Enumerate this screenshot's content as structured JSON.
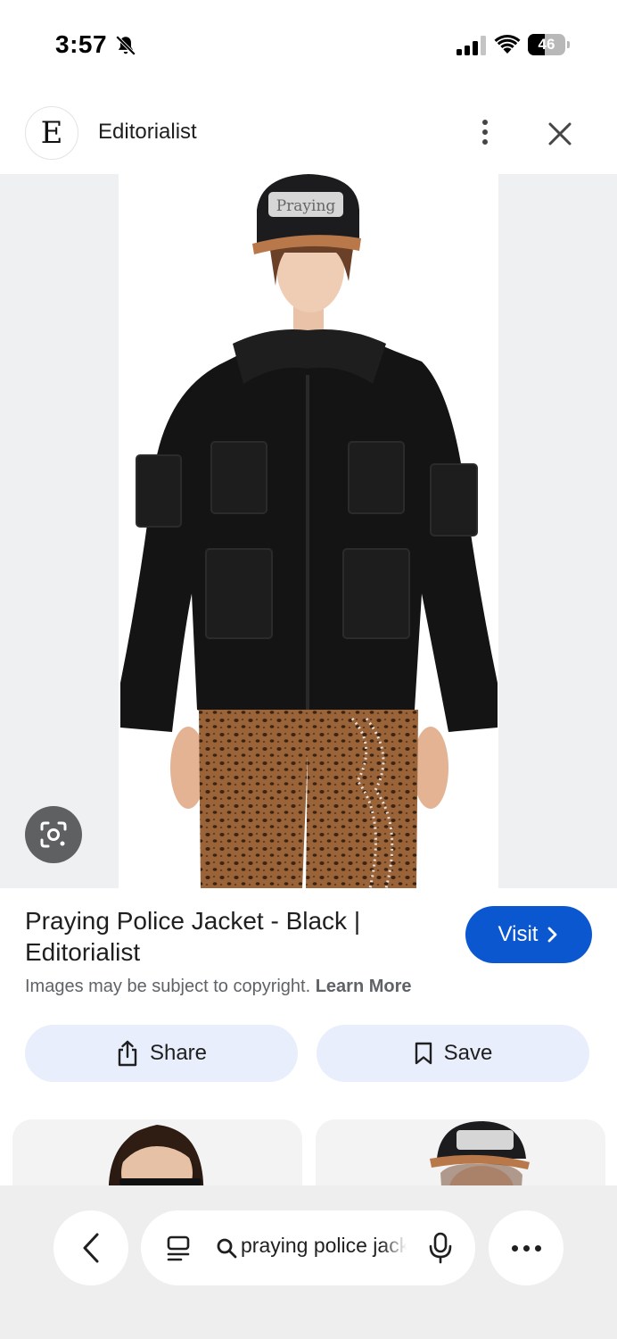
{
  "status_bar": {
    "time": "3:57",
    "battery_percent": 46,
    "battery_label": "46"
  },
  "source": {
    "logo_letter": "E",
    "name": "Editorialist"
  },
  "result": {
    "title": "Praying Police Jacket - Black | Editorialist",
    "visit_label": "Visit",
    "copyright_text": "Images may be subject to copyright.",
    "learn_more_label": "Learn More",
    "share_label": "Share",
    "save_label": "Save"
  },
  "hat_text": "Praying",
  "bottom_bar": {
    "search_query": "praying police jacket"
  },
  "colors": {
    "visit_button": "#0b57d0",
    "action_button_bg": "#e8eefb",
    "jacket": "#141414",
    "pants": "#8a5a35"
  }
}
